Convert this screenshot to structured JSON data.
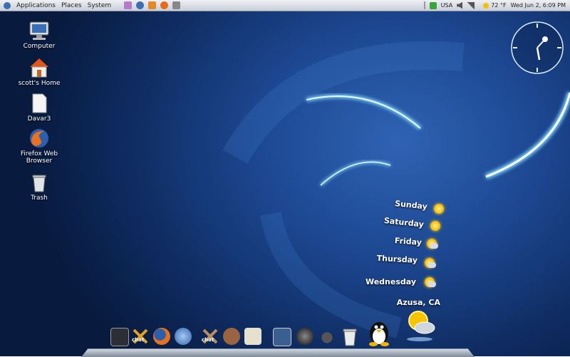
{
  "top_panel": {
    "menus": [
      "Applications",
      "Places",
      "System"
    ],
    "tray": {
      "keyboard_layout": "USA",
      "temperature": "72 °F",
      "datetime": "Wed Jun 2, 6:09 PM"
    }
  },
  "desktop_icons": [
    {
      "label": "Computer",
      "icon": "computer-icon"
    },
    {
      "label": "scott's Home",
      "icon": "home-folder-icon"
    },
    {
      "label": "Davar3",
      "icon": "document-icon"
    },
    {
      "label": "Firefox Web Browser",
      "icon": "firefox-icon"
    },
    {
      "label": "Trash",
      "icon": "trash-icon"
    }
  ],
  "weather_widget": {
    "location": "Azusa, CA",
    "forecast": [
      {
        "day": "Sunday",
        "icon": "sunny-icon"
      },
      {
        "day": "Saturday",
        "icon": "sunny-icon"
      },
      {
        "day": "Friday",
        "icon": "partly-cloudy-icon"
      },
      {
        "day": "Thursday",
        "icon": "partly-cloudy-icon"
      },
      {
        "day": "Wednesday",
        "icon": "partly-cloudy-icon"
      }
    ]
  },
  "dock": {
    "items": [
      "terminal-icon",
      "chat-icon",
      "firefox-icon",
      "thunderbird-icon",
      "chat-icon",
      "gimp-icon",
      "text-editor-icon",
      "screenshot-icon",
      "media-player-icon",
      "gnome-foot-icon",
      "trash-icon",
      "tux-icon",
      "weather-icon"
    ],
    "chat_label": "chat"
  },
  "colors": {
    "background": "#1c468f",
    "swirl": "#7fd4ff",
    "panel": "#d7dbe3"
  }
}
